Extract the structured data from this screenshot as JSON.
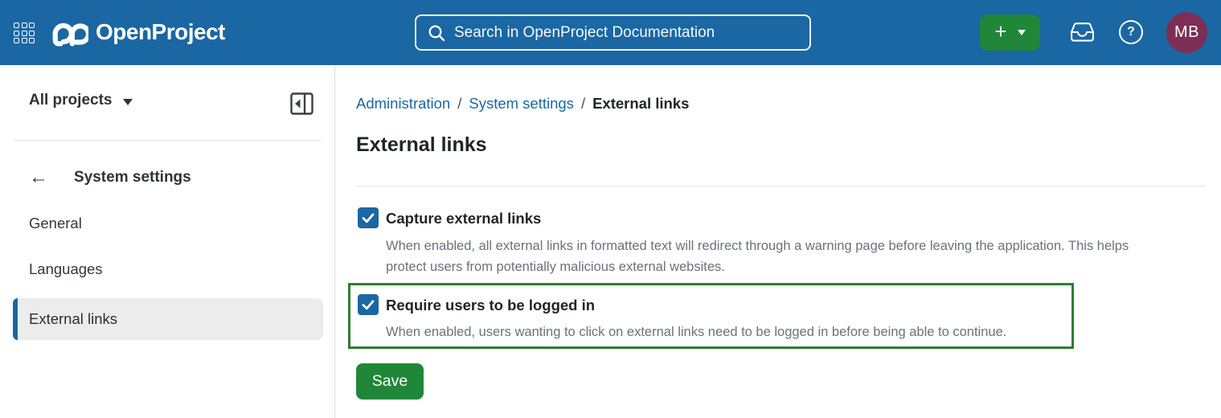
{
  "header": {
    "app_name": "OpenProject",
    "search_placeholder": "Search in OpenProject Documentation",
    "add_button_plus": "+",
    "help_glyph": "?",
    "avatar_initials": "MB"
  },
  "sidebar": {
    "project_filter_label": "All projects",
    "back_arrow": "←",
    "section_title": "System settings",
    "items": [
      {
        "label": "General",
        "active": false
      },
      {
        "label": "Languages",
        "active": false
      },
      {
        "label": "External links",
        "active": true
      }
    ]
  },
  "main": {
    "breadcrumb": {
      "items": [
        {
          "label": "Administration"
        },
        {
          "label": "System settings"
        },
        {
          "label": "External links"
        }
      ],
      "separator": "/"
    },
    "page_title": "External links",
    "settings": [
      {
        "label": "Capture external links",
        "checked": true,
        "highlighted": false,
        "description": "When enabled, all external links in formatted text will redirect through a warning page before leaving the application. This helps protect users from potentially malicious external websites."
      },
      {
        "label": "Require users to be logged in",
        "checked": true,
        "highlighted": true,
        "description": "When enabled, users wanting to click on external links need to be logged in before being able to continue."
      }
    ],
    "save_button": "Save"
  },
  "colors": {
    "header_bg": "#1A67A3",
    "link_blue": "#1A67A3",
    "checkbox_blue": "#1A67A3",
    "button_green": "#218738",
    "highlight_border_green": "#2E7D32",
    "avatar_bg": "#7D2E55",
    "active_item_bg": "#ECECEC",
    "description_text": "#6A727C"
  }
}
